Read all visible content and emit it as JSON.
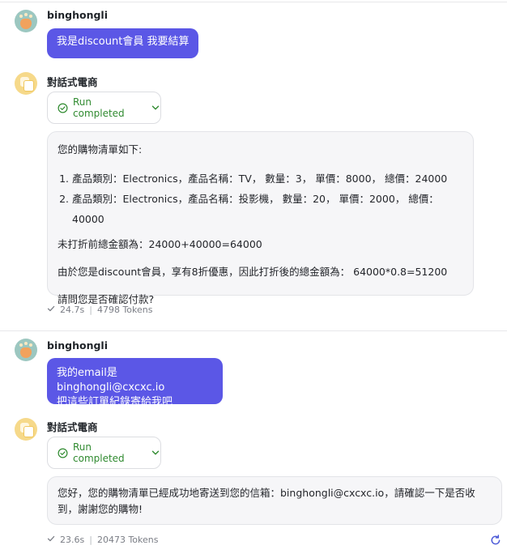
{
  "conversation": {
    "turn1": {
      "user_name": "binghongli",
      "user_message": "我是discount會員 我要結算",
      "bot_name": "對話式電商",
      "run_status": "Run completed",
      "reply": {
        "intro": "您的購物清單如下:",
        "items": [
          "產品類別：Electronics，產品名稱：TV， 數量：3， 單價：8000， 總價：24000",
          "產品類別：Electronics，產品名稱：投影機， 數量：20， 單價：2000， 總價：40000"
        ],
        "subtotal": "未打折前總金額為：24000+40000=64000",
        "discount": "由於您是discount會員，享有8折優惠，因此打折後的總金額為： 64000*0.8=51200",
        "question": "請問您是否確認付款?"
      },
      "time": "24.7s",
      "tokens": "4798 Tokens"
    },
    "turn2": {
      "user_name": "binghongli",
      "user_message_line1": "我的email是binghongli@cxcxc.io",
      "user_message_line2": "把這些訂單紀錄寄給我吧",
      "bot_name": "對話式電商",
      "run_status": "Run completed",
      "reply": "您好，您的購物清單已經成功地寄送到您的信箱：binghongli@cxcxc.io，請確認一下是否收到，謝謝您的購物!",
      "time": "23.6s",
      "tokens": "20473 Tokens"
    }
  },
  "icons": {
    "status": "check-circle-icon",
    "expand": "chevron-down-icon",
    "meta_check": "check-icon",
    "refresh": "refresh-icon"
  },
  "colors": {
    "user_bubble": "#5b57e6",
    "success": "#2f8a2f",
    "bot_bubble_bg": "#f6f6f8",
    "refresh": "#4d5bd8"
  }
}
